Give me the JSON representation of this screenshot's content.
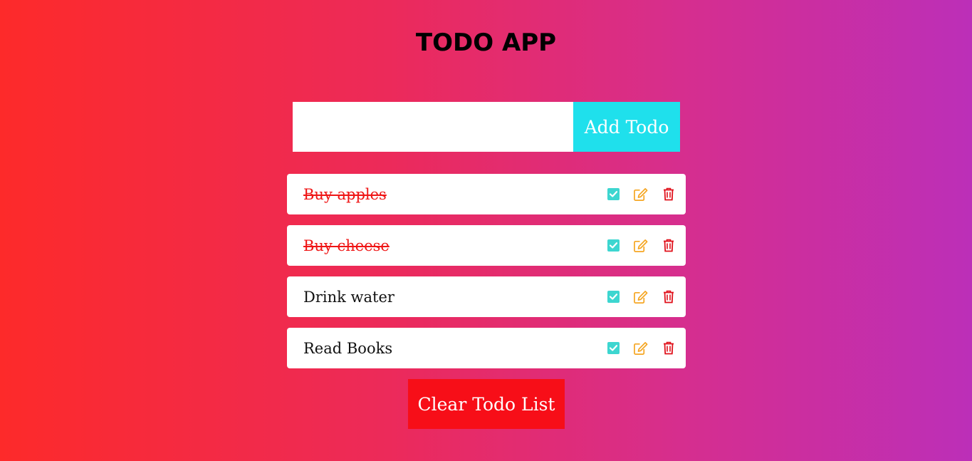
{
  "app": {
    "title": "TODO APP"
  },
  "form": {
    "input_value": "",
    "input_placeholder": "",
    "add_label": "Add Todo"
  },
  "todos": [
    {
      "text": "Buy apples",
      "completed": true
    },
    {
      "text": "Buy cheese",
      "completed": true
    },
    {
      "text": "Drink water",
      "completed": false
    },
    {
      "text": "Read Books",
      "completed": false
    }
  ],
  "icons": {
    "complete": "check-square-icon",
    "edit": "edit-icon",
    "delete": "trash-icon"
  },
  "colors": {
    "accent_cyan": "#1fe0ec",
    "check_color": "#3dd6d0",
    "edit_color": "#f5a623",
    "delete_color": "#e0101a",
    "done_text": "#ef1515",
    "clear_button": "#f70e18"
  },
  "footer": {
    "clear_label": "Clear Todo List"
  }
}
